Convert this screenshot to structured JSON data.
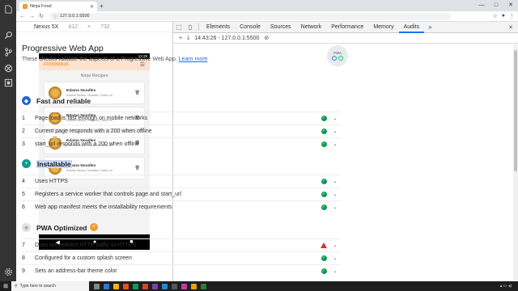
{
  "browser": {
    "tab_title": "Ninja Food",
    "url": "127.0.0.1:5500",
    "new_tab": "+",
    "window_controls": [
      "—",
      "□",
      "✕"
    ]
  },
  "device": {
    "name": "Nexus 5X",
    "width": "412",
    "sep": "×",
    "height": "732"
  },
  "app": {
    "status_time": "12:29",
    "logo": "FOODNINJA",
    "heading": "Ninja Recipes",
    "recipes": [
      {
        "name": "Edamo Noodles",
        "ingredients": "Edame Beans, Noodles, Garlic oil"
      },
      {
        "name": "Edamo Noodles",
        "ingredients": "Edame Beans, Noodles, Garlic oil"
      },
      {
        "name": "Edamo Noodles",
        "ingredients": "Edame Beans, Noodles, Garlic oil"
      },
      {
        "name": "Edamo Noodles",
        "ingredients": "Edame Beans, Noodles, Garlic oil"
      }
    ],
    "fab": "+"
  },
  "devtools": {
    "tabs": [
      "Elements",
      "Console",
      "Sources",
      "Network",
      "Performance",
      "Memory",
      "Audits"
    ],
    "active_tab": "Audits",
    "more": "»",
    "sub_label": "14:43:26 - 127.0.0.1:5500",
    "report": {
      "title": "Progressive Web App",
      "desc": "These checks validate the aspects of a Progressive Web App.",
      "learn_more": "Learn more",
      "badge": "PWA",
      "sections": [
        {
          "title": "Fast and reliable",
          "audits": [
            {
              "num": "1",
              "text": "Page load is fast enough on mobile networks",
              "status": "pass"
            },
            {
              "num": "2",
              "text": "Current page responds with a 200 when offline",
              "status": "pass"
            },
            {
              "num": "3",
              "text": "start_url responds with a 200 when offline",
              "status": "pass"
            }
          ]
        },
        {
          "title": "Installable",
          "audits": [
            {
              "num": "4",
              "text": "Uses HTTPS",
              "status": "pass"
            },
            {
              "num": "5",
              "text": "Registers a service worker that controls page and start_url",
              "status": "pass"
            },
            {
              "num": "6",
              "text": "Web app manifest meets the installability requirements",
              "status": "pass"
            }
          ]
        },
        {
          "title": "PWA Optimized",
          "audits": [
            {
              "num": "7",
              "text": "Does not redirect HTTP traffic to HTTPS",
              "status": "fail"
            },
            {
              "num": "8",
              "text": "Configured for a custom splash screen",
              "status": "pass"
            },
            {
              "num": "9",
              "text": "Sets an address-bar theme color",
              "status": "pass"
            }
          ]
        }
      ]
    }
  },
  "taskbar": {
    "search_placeholder": "Type here to search"
  },
  "colors": {
    "accent": "#f29b31",
    "pass": "#0c9b4e",
    "fail": "#d93025",
    "link": "#1a73e8"
  }
}
